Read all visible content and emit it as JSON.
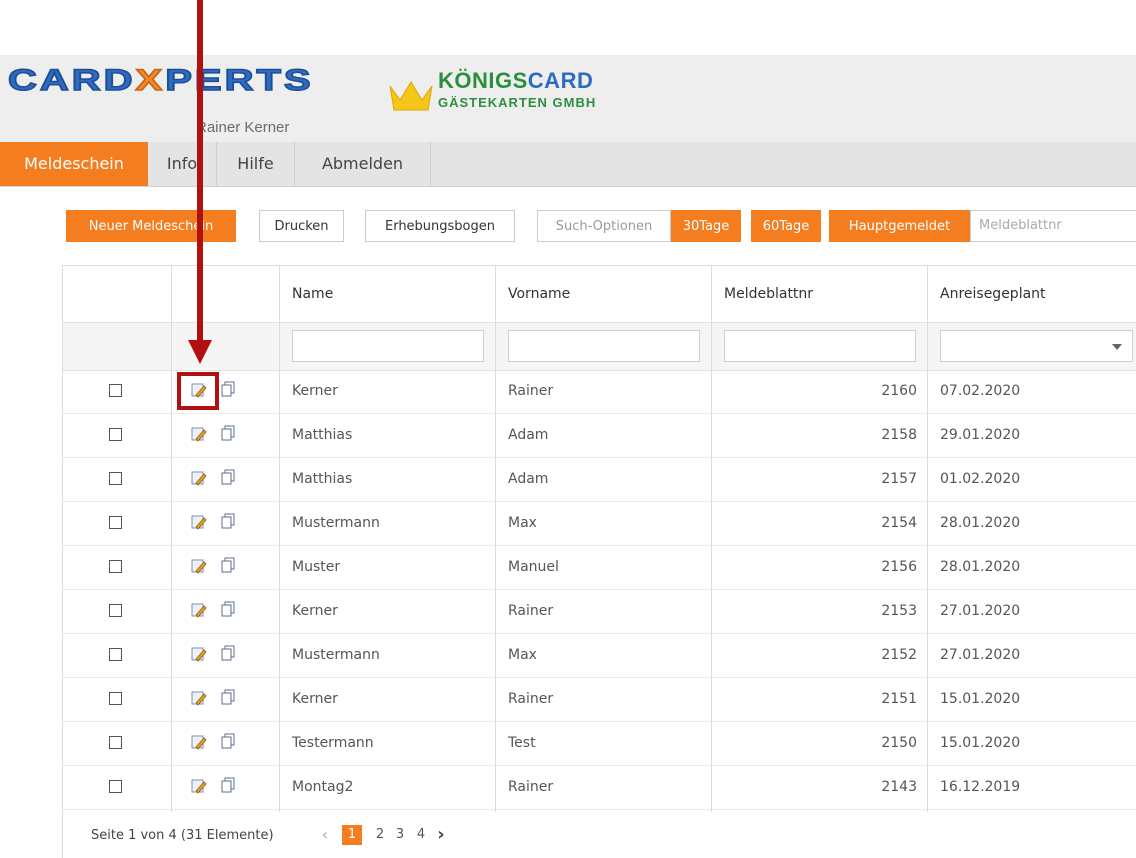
{
  "logo": {
    "cardxperts_pre": "CARD",
    "cardxperts_x": "X",
    "cardxperts_post": "PERTS",
    "subtitle": "Rainer Kerner",
    "koenigscard_a": "KÖNIGS",
    "koenigscard_b": "CARD",
    "koenigscard_sub": "GÄSTEKARTEN GMBH"
  },
  "nav": {
    "items": [
      {
        "label": "Meldeschein",
        "active": true
      },
      {
        "label": "Info",
        "active": false
      },
      {
        "label": "Hilfe",
        "active": false
      },
      {
        "label": "Abmelden",
        "active": false
      }
    ]
  },
  "toolbar": {
    "new_label": "Neuer Meldeschein",
    "print_label": "Drucken",
    "survey_label": "Erhebungsbogen",
    "search_options_label": "Such-Optionen",
    "days30_label": "30Tage",
    "days60_label": "60Tage",
    "main_registered_label": "Hauptgemeldet",
    "search_placeholder": "Meldeblattnr"
  },
  "table": {
    "columns": [
      "Name",
      "Vorname",
      "Meldeblattnr",
      "Anreisegeplant"
    ],
    "rows": [
      {
        "name": "Kerner",
        "vorname": "Rainer",
        "nr": "2160",
        "date": "07.02.2020"
      },
      {
        "name": "Matthias",
        "vorname": "Adam",
        "nr": "2158",
        "date": "29.01.2020"
      },
      {
        "name": "Matthias",
        "vorname": "Adam",
        "nr": "2157",
        "date": "01.02.2020"
      },
      {
        "name": "Mustermann",
        "vorname": "Max",
        "nr": "2154",
        "date": "28.01.2020"
      },
      {
        "name": "Muster",
        "vorname": "Manuel",
        "nr": "2156",
        "date": "28.01.2020"
      },
      {
        "name": "Kerner",
        "vorname": "Rainer",
        "nr": "2153",
        "date": "27.01.2020"
      },
      {
        "name": "Mustermann",
        "vorname": "Max",
        "nr": "2152",
        "date": "27.01.2020"
      },
      {
        "name": "Kerner",
        "vorname": "Rainer",
        "nr": "2151",
        "date": "15.01.2020"
      },
      {
        "name": "Testermann",
        "vorname": "Test",
        "nr": "2150",
        "date": "15.01.2020"
      },
      {
        "name": "Montag2",
        "vorname": "Rainer",
        "nr": "2143",
        "date": "16.12.2019"
      }
    ]
  },
  "pager": {
    "summary": "Seite 1 von 4 (31 Elemente)",
    "pages": [
      "1",
      "2",
      "3",
      "4"
    ],
    "active_page": "1"
  },
  "colors": {
    "accent": "#f47d20",
    "annotation": "#b01010"
  }
}
